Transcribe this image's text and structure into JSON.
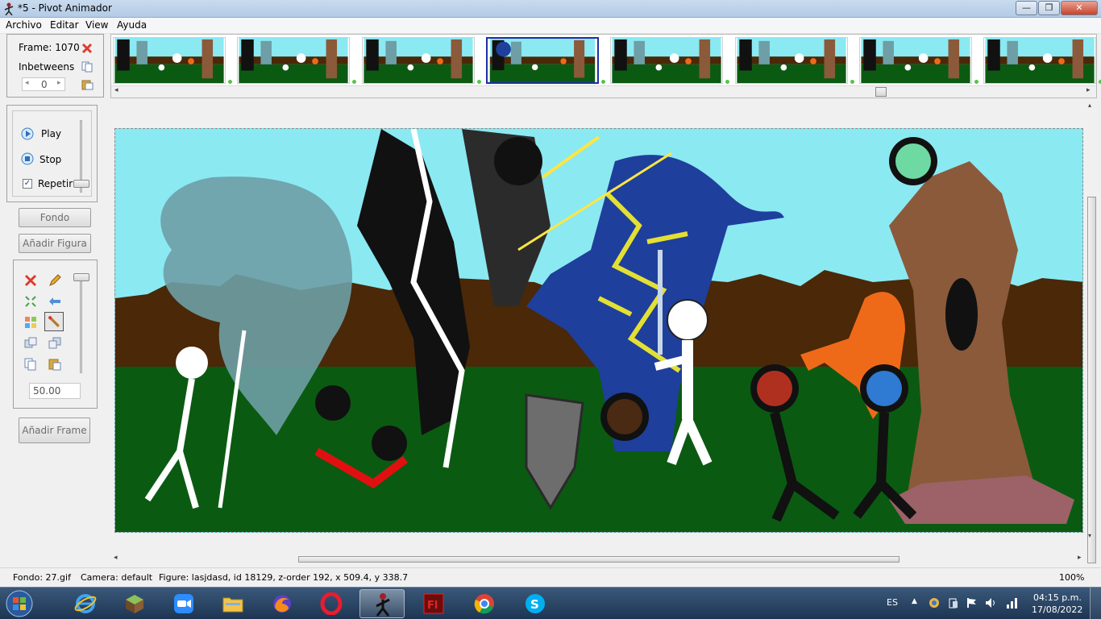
{
  "window": {
    "title": "*5 - Pivot Animador",
    "minimize_glyph": "—",
    "maximize_glyph": "❐",
    "close_glyph": "✕"
  },
  "menu": [
    "Archivo",
    "Editar",
    "View",
    "Ayuda"
  ],
  "frame_panel": {
    "frame_label": "Frame: 1070",
    "inbetweens_label": "Inbetweens",
    "inbetweens_value": "0"
  },
  "playback": {
    "play_label": "Play",
    "stop_label": "Stop",
    "repeat_label": "Repetir",
    "repeat_checked": true
  },
  "buttons": {
    "background": "Fondo",
    "add_figure": "Añadir Figura",
    "add_frame": "Añadir Frame"
  },
  "figure_tools": {
    "scale_value": "50.00"
  },
  "thumbnails": {
    "count": 8,
    "selected_index": 3
  },
  "status": {
    "background": "Fondo: 27.gif",
    "camera": "Camera: default",
    "figure": "Figure: lasjdasd,  id 18129,  z-order 192,  x 509.4, y 338.7",
    "zoom": "100%"
  },
  "taskbar": {
    "apps": [
      "start-orb",
      "internet-explorer",
      "minecraft",
      "zoom",
      "file-explorer",
      "firefox",
      "opera",
      "pivot-animator",
      "flash",
      "chrome",
      "skype"
    ],
    "active_app": "pivot-animator",
    "lang": "ES",
    "time": "04:15 p.m.",
    "date": "17/08/2022"
  },
  "colors": {
    "sky": "#8be9f2",
    "ground": "#0b5a12",
    "fence": "#4a2808",
    "selection": "#1b2fa8"
  }
}
